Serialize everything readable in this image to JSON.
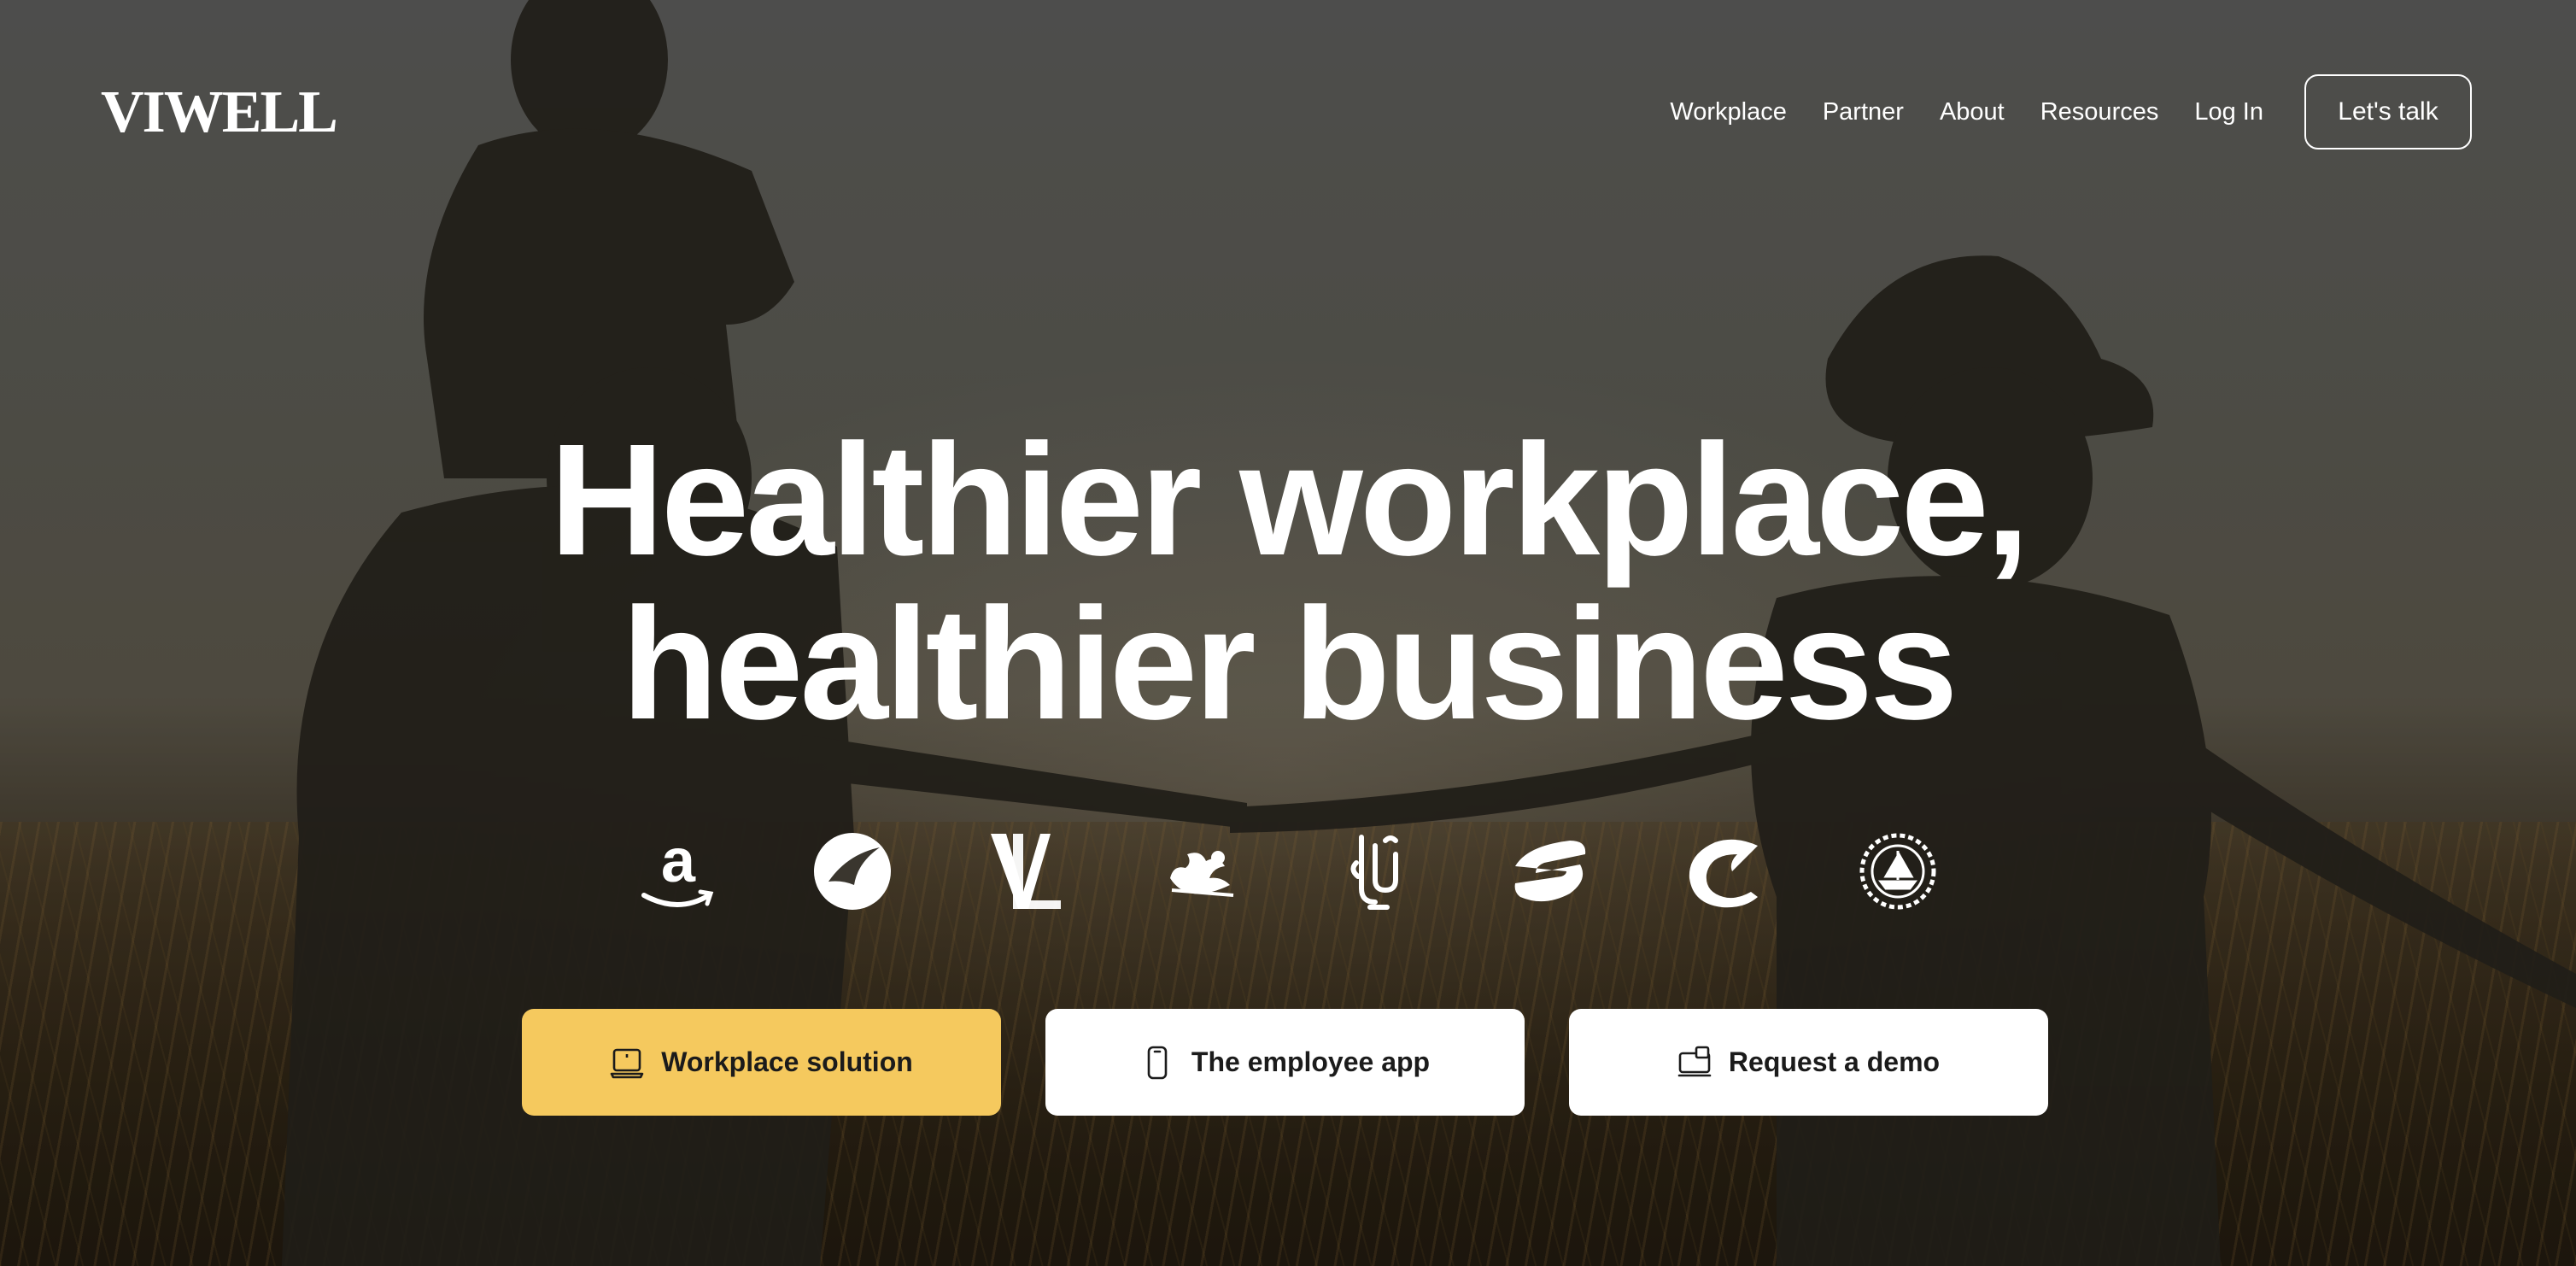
{
  "brand": {
    "name": "VIWELL"
  },
  "nav": {
    "items": [
      {
        "label": "Workplace"
      },
      {
        "label": "Partner"
      },
      {
        "label": "About"
      },
      {
        "label": "Resources"
      },
      {
        "label": "Log In"
      }
    ],
    "cta_label": "Let's talk"
  },
  "hero": {
    "title_line1": "Healthier workplace,",
    "title_line2": "healthier business"
  },
  "client_logos": [
    {
      "name": "amazon-logo"
    },
    {
      "name": "turkish-airlines-logo"
    },
    {
      "name": "louis-vuitton-logo"
    },
    {
      "name": "nestle-logo"
    },
    {
      "name": "emirates-logo"
    },
    {
      "name": "etisalat-logo"
    },
    {
      "name": "etihad-c-logo"
    },
    {
      "name": "emblem-logo"
    }
  ],
  "actions": {
    "workplace_label": "Workplace solution",
    "app_label": "The employee app",
    "demo_label": "Request a demo"
  },
  "colors": {
    "primary_button": "#f5c95e",
    "secondary_button": "#ffffff",
    "text_light": "#ffffff",
    "text_dark": "#1b1b1b"
  }
}
